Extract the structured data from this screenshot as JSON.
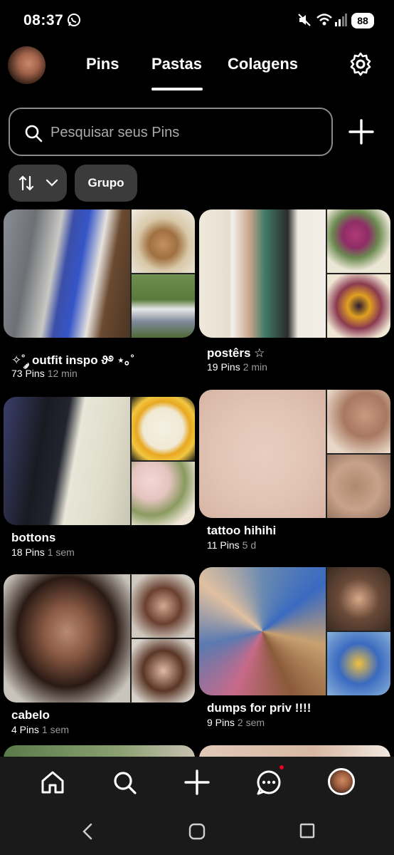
{
  "status_bar": {
    "time": "08:37",
    "battery": "88",
    "icons": [
      "whatsapp-icon",
      "mute-icon",
      "wifi-icon",
      "signal-icon",
      "battery-icon"
    ]
  },
  "header": {
    "tabs": [
      {
        "label": "Pins",
        "active": false
      },
      {
        "label": "Pastas",
        "active": true
      },
      {
        "label": "Colagens",
        "active": false
      }
    ],
    "settings_icon": "gear-icon"
  },
  "search": {
    "placeholder": "Pesquisar seus Pins",
    "add_icon": "plus-icon"
  },
  "filters": {
    "sort_icon": "sort-arrows-icon",
    "group_label": "Grupo"
  },
  "boards": [
    {
      "title": "✧˚ ༘ outfit inspo ϑ࿔ ⋆｡˚",
      "count": "73 Pins",
      "updated": "12 min"
    },
    {
      "title": "postêrs ☆",
      "count": "19 Pins",
      "updated": "2 min"
    },
    {
      "title": "bottons",
      "count": "18 Pins",
      "updated": "1 sem"
    },
    {
      "title": "tattoo hihihi",
      "count": "11 Pins",
      "updated": "5 d"
    },
    {
      "title": "cabelo",
      "count": "4 Pins",
      "updated": "1 sem"
    },
    {
      "title": "dumps for priv !!!!",
      "count": "9 Pins",
      "updated": "2 sem"
    }
  ],
  "bottom_nav": {
    "items": [
      "home-icon",
      "search-icon",
      "create-icon",
      "messages-icon",
      "profile-avatar"
    ],
    "notification": true
  },
  "android_nav": [
    "back-icon",
    "home-button-icon",
    "recents-icon"
  ],
  "colors": {
    "background": "#000000",
    "chip": "#3b3b3b",
    "nav": "#1a1a1a",
    "accent_red": "#e60023",
    "muted_text": "#9a9a9a"
  }
}
